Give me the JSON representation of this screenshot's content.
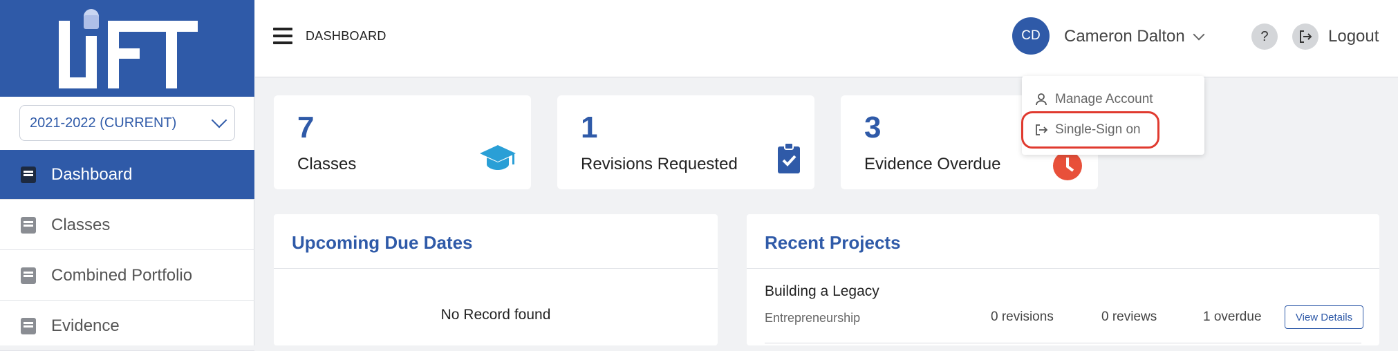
{
  "app": {
    "logo_text": "LiFT"
  },
  "sidebar": {
    "year_select": "2021-2022 (CURRENT)",
    "items": [
      {
        "label": "Dashboard",
        "active": true
      },
      {
        "label": "Classes",
        "active": false
      },
      {
        "label": "Combined Portfolio",
        "active": false
      },
      {
        "label": "Evidence",
        "active": false
      }
    ]
  },
  "header": {
    "breadcrumb": "DASHBOARD",
    "avatar_initials": "CD",
    "user_name": "Cameron Dalton",
    "help_label": "?",
    "logout_label": "Logout"
  },
  "user_menu": {
    "items": [
      {
        "label": "Manage Account",
        "icon": "person-icon"
      },
      {
        "label": "Single-Sign on",
        "icon": "sign-in-icon"
      }
    ]
  },
  "stats": [
    {
      "value": "7",
      "label": "Classes",
      "icon": "graduation-cap-icon",
      "color": "#2a9fd6"
    },
    {
      "value": "1",
      "label": "Revisions Requested",
      "icon": "clipboard-check-icon",
      "color": "#2f5aa8"
    },
    {
      "value": "3",
      "label": "Evidence Overdue",
      "icon": "clock-icon",
      "color": "#e8503a"
    }
  ],
  "upcoming": {
    "title": "Upcoming Due Dates",
    "empty_text": "No Record found"
  },
  "recent_projects": {
    "title": "Recent Projects",
    "items": [
      {
        "title": "Building a Legacy",
        "subject": "Entrepreneurship",
        "revisions": "0 revisions",
        "reviews": "0 reviews",
        "overdue": "1 overdue",
        "action": "View Details"
      }
    ]
  },
  "colors": {
    "brand": "#2f5aa8",
    "highlight": "#e03a2f"
  }
}
